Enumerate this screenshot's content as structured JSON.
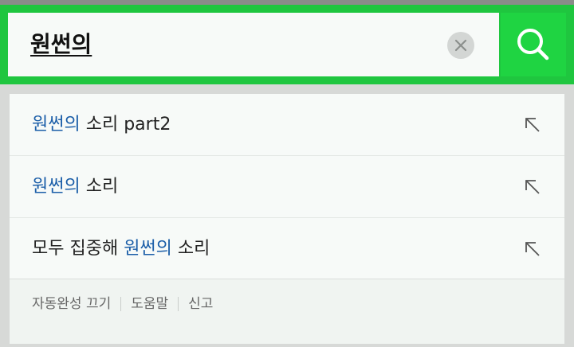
{
  "search": {
    "query": "원썬의",
    "clear_icon": "close-icon",
    "submit_icon": "search-icon"
  },
  "suggestions": [
    {
      "before": "",
      "highlight": "원썬의",
      "after": " 소리 part2",
      "icon": "arrow-up-left-icon"
    },
    {
      "before": "",
      "highlight": "원썬의",
      "after": " 소리",
      "icon": "arrow-up-left-icon"
    },
    {
      "before": "모두 집중해 ",
      "highlight": "원썬의",
      "after": " 소리",
      "icon": "arrow-up-left-icon"
    }
  ],
  "footer": {
    "autocomplete_off": "자동완성 끄기",
    "help": "도움말",
    "report": "신고"
  },
  "colors": {
    "brand_green": "#1fc63f",
    "search_button": "#1fd442",
    "highlight": "#1b5ea8"
  }
}
